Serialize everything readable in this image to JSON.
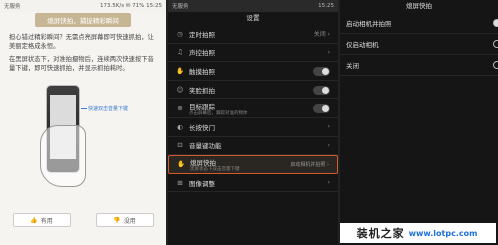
{
  "left": {
    "status_left": "无服务",
    "status_right": "173.5K/s ✉ 71% 15:25",
    "header": "熄屏快拍，捕捉精彩瞬间",
    "para1": "担心错过精彩瞬间？无需点亮屏幕即可快速抓拍，让美丽定格成永恒。",
    "para2": "在黑屏状态下，对准拍摄物后，连续两次快速按下音量下键，即可快速抓拍，并显示抓拍耗时。",
    "arrow_label": "快速双击音量下键",
    "btn_useful": "有用",
    "btn_useless": "没用"
  },
  "middle": {
    "status_left": "无服务",
    "status_right": "15:25",
    "title": "设置",
    "items": [
      {
        "icon": "◷",
        "label": "定时拍照",
        "right": "关闭 ›"
      },
      {
        "icon": "♫",
        "label": "声控拍照",
        "right": "›"
      },
      {
        "icon": "✋",
        "label": "触摸拍照"
      },
      {
        "icon": "☺",
        "label": "笑脸抓拍"
      },
      {
        "icon": "⊕",
        "label": "目标跟踪",
        "sub": "点击屏幕后，跟踪对准的物体"
      },
      {
        "icon": "◐",
        "label": "长按快门",
        "right": "›"
      },
      {
        "icon": "⊡",
        "label": "音量键功能",
        "right": "›"
      },
      {
        "icon": "✋",
        "label": "熄屏快拍",
        "sub": "黑屏状态下双击音量下键",
        "right": "启动相机并拍照 ›"
      },
      {
        "icon": "⊞",
        "label": "图像调整",
        "right": "›"
      }
    ]
  },
  "right": {
    "title": "熄屏快拍",
    "options": [
      "启动相机并拍照",
      "仅启动相机",
      "关闭"
    ],
    "selected": 0
  },
  "watermark": {
    "cn": "装机之家",
    "url": "www.lotpc.com"
  }
}
